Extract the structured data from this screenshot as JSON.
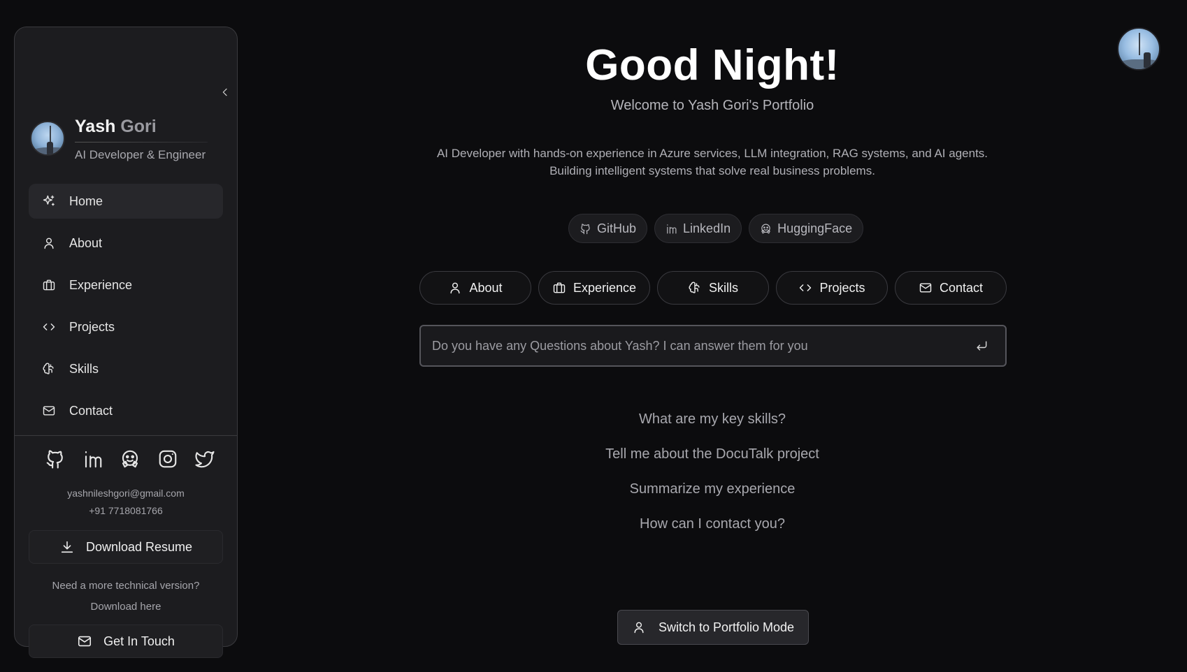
{
  "sidebar": {
    "collapse_icon": "chevron-left-icon",
    "profile": {
      "first_name": "Yash",
      "last_name": "Gori",
      "role": "AI Developer & Engineer"
    },
    "nav": [
      {
        "label": "Home",
        "icon": "sparkles-icon",
        "active": true
      },
      {
        "label": "About",
        "icon": "user-icon"
      },
      {
        "label": "Experience",
        "icon": "briefcase-icon"
      },
      {
        "label": "Projects",
        "icon": "code-icon"
      },
      {
        "label": "Skills",
        "icon": "brain-icon"
      },
      {
        "label": "Contact",
        "icon": "mail-icon"
      }
    ],
    "socials": [
      "github-icon",
      "linkedin-icon",
      "huggingface-icon",
      "instagram-icon",
      "twitter-icon"
    ],
    "email": "yashnileshgori@gmail.com",
    "phone": "+91 7718081766",
    "resume_button": "Download Resume",
    "tech_note": "Need a more technical version?",
    "tech_link": "Download here",
    "touch_button": "Get In Touch"
  },
  "main": {
    "greeting": "Good Night!",
    "welcome": "Welcome to Yash Gori's Portfolio",
    "intro_line1": "AI Developer with hands-on experience in Azure services, LLM integration, RAG systems, and AI agents.",
    "intro_line2": "Building intelligent systems that solve real business problems.",
    "chips": [
      {
        "label": "GitHub",
        "icon": "github-icon"
      },
      {
        "label": "LinkedIn",
        "icon": "linkedin-icon"
      },
      {
        "label": "HuggingFace",
        "icon": "huggingface-icon"
      }
    ],
    "nav_buttons": [
      {
        "label": "About",
        "icon": "user-icon"
      },
      {
        "label": "Experience",
        "icon": "briefcase-icon"
      },
      {
        "label": "Skills",
        "icon": "brain-icon"
      },
      {
        "label": "Projects",
        "icon": "code-icon"
      },
      {
        "label": "Contact",
        "icon": "mail-icon"
      }
    ],
    "ask_placeholder": "Do you have any Questions about Yash? I can answer them for you",
    "ask_value": "",
    "suggestions": [
      "What are my key skills?",
      "Tell me about the DocuTalk project",
      "Summarize my experience",
      "How can I contact you?"
    ],
    "switch_button": "Switch to Portfolio Mode"
  },
  "colors": {
    "background": "#0c0c0e",
    "sidebar": "#1c1c1f",
    "text": "#e6e6e6",
    "muted": "#a8a8ae"
  }
}
